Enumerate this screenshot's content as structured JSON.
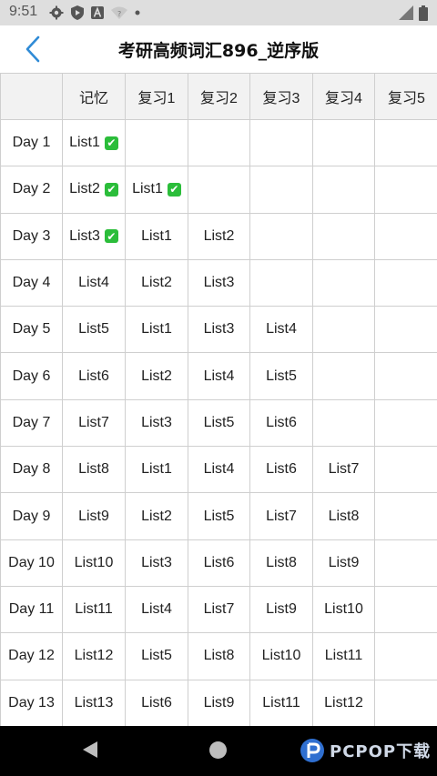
{
  "status_bar": {
    "time": "9:51",
    "left_icons": [
      "settings-icon",
      "shield-icon",
      "a-icon",
      "wifi-question-icon",
      "dot-icon"
    ],
    "right_icons": [
      "signal-icon",
      "battery-icon"
    ]
  },
  "header": {
    "back_icon": "chevron-left-icon",
    "title": "考研高频词汇896_逆序版",
    "accent_color": "#2f8bd6"
  },
  "table": {
    "columns": [
      "",
      "记忆",
      "复习1",
      "复习2",
      "复习3",
      "复习4",
      "复习5"
    ],
    "rows": [
      {
        "day": "Day 1",
        "cells": [
          {
            "text": "List1",
            "done": true
          },
          {
            "text": "",
            "done": false
          },
          {
            "text": "",
            "done": false
          },
          {
            "text": "",
            "done": false
          },
          {
            "text": "",
            "done": false
          },
          {
            "text": "",
            "done": false
          }
        ]
      },
      {
        "day": "Day 2",
        "cells": [
          {
            "text": "List2",
            "done": true
          },
          {
            "text": "List1",
            "done": true
          },
          {
            "text": "",
            "done": false
          },
          {
            "text": "",
            "done": false
          },
          {
            "text": "",
            "done": false
          },
          {
            "text": "",
            "done": false
          }
        ]
      },
      {
        "day": "Day 3",
        "cells": [
          {
            "text": "List3",
            "done": true
          },
          {
            "text": "List1",
            "done": false
          },
          {
            "text": "List2",
            "done": false
          },
          {
            "text": "",
            "done": false
          },
          {
            "text": "",
            "done": false
          },
          {
            "text": "",
            "done": false
          }
        ]
      },
      {
        "day": "Day 4",
        "cells": [
          {
            "text": "List4",
            "done": false
          },
          {
            "text": "List2",
            "done": false
          },
          {
            "text": "List3",
            "done": false
          },
          {
            "text": "",
            "done": false
          },
          {
            "text": "",
            "done": false
          },
          {
            "text": "",
            "done": false
          }
        ]
      },
      {
        "day": "Day 5",
        "cells": [
          {
            "text": "List5",
            "done": false
          },
          {
            "text": "List1",
            "done": false
          },
          {
            "text": "List3",
            "done": false
          },
          {
            "text": "List4",
            "done": false
          },
          {
            "text": "",
            "done": false
          },
          {
            "text": "",
            "done": false
          }
        ]
      },
      {
        "day": "Day 6",
        "cells": [
          {
            "text": "List6",
            "done": false
          },
          {
            "text": "List2",
            "done": false
          },
          {
            "text": "List4",
            "done": false
          },
          {
            "text": "List5",
            "done": false
          },
          {
            "text": "",
            "done": false
          },
          {
            "text": "",
            "done": false
          }
        ]
      },
      {
        "day": "Day 7",
        "cells": [
          {
            "text": "List7",
            "done": false
          },
          {
            "text": "List3",
            "done": false
          },
          {
            "text": "List5",
            "done": false
          },
          {
            "text": "List6",
            "done": false
          },
          {
            "text": "",
            "done": false
          },
          {
            "text": "",
            "done": false
          }
        ]
      },
      {
        "day": "Day 8",
        "cells": [
          {
            "text": "List8",
            "done": false
          },
          {
            "text": "List1",
            "done": false
          },
          {
            "text": "List4",
            "done": false
          },
          {
            "text": "List6",
            "done": false
          },
          {
            "text": "List7",
            "done": false
          },
          {
            "text": "",
            "done": false
          }
        ]
      },
      {
        "day": "Day 9",
        "cells": [
          {
            "text": "List9",
            "done": false
          },
          {
            "text": "List2",
            "done": false
          },
          {
            "text": "List5",
            "done": false
          },
          {
            "text": "List7",
            "done": false
          },
          {
            "text": "List8",
            "done": false
          },
          {
            "text": "",
            "done": false
          }
        ]
      },
      {
        "day": "Day 10",
        "cells": [
          {
            "text": "List10",
            "done": false
          },
          {
            "text": "List3",
            "done": false
          },
          {
            "text": "List6",
            "done": false
          },
          {
            "text": "List8",
            "done": false
          },
          {
            "text": "List9",
            "done": false
          },
          {
            "text": "",
            "done": false
          }
        ]
      },
      {
        "day": "Day 11",
        "cells": [
          {
            "text": "List11",
            "done": false
          },
          {
            "text": "List4",
            "done": false
          },
          {
            "text": "List7",
            "done": false
          },
          {
            "text": "List9",
            "done": false
          },
          {
            "text": "List10",
            "done": false
          },
          {
            "text": "",
            "done": false
          }
        ]
      },
      {
        "day": "Day 12",
        "cells": [
          {
            "text": "List12",
            "done": false
          },
          {
            "text": "List5",
            "done": false
          },
          {
            "text": "List8",
            "done": false
          },
          {
            "text": "List10",
            "done": false
          },
          {
            "text": "List11",
            "done": false
          },
          {
            "text": "",
            "done": false
          }
        ]
      },
      {
        "day": "Day 13",
        "cells": [
          {
            "text": "List13",
            "done": false
          },
          {
            "text": "List6",
            "done": false
          },
          {
            "text": "List9",
            "done": false
          },
          {
            "text": "List11",
            "done": false
          },
          {
            "text": "List12",
            "done": false
          },
          {
            "text": "",
            "done": false
          }
        ]
      }
    ],
    "check_color": "#2bbd3a"
  },
  "nav_bar": {
    "icons": [
      "nav-back-icon",
      "nav-home-icon"
    ],
    "watermark": "PCPOP下载"
  }
}
